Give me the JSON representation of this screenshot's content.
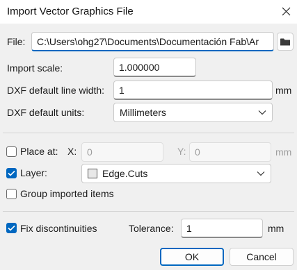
{
  "window": {
    "title": "Import Vector Graphics File",
    "close_icon": "close-icon"
  },
  "file": {
    "label": "File:",
    "value": "C:\\Users\\ohg27\\Documents\\Documentación Fab\\Ar",
    "browse_icon": "folder-icon"
  },
  "import_scale": {
    "label": "Import scale:",
    "value": "1.000000"
  },
  "dxf_line_width": {
    "label": "DXF default line width:",
    "value": "1",
    "unit": "mm"
  },
  "dxf_units": {
    "label": "DXF default units:",
    "selected": "Millimeters"
  },
  "place_at": {
    "label": "Place at:",
    "checked": false,
    "x_label": "X:",
    "x_value": "0",
    "y_label": "Y:",
    "y_value": "0",
    "unit": "mm"
  },
  "layer": {
    "label": "Layer:",
    "checked": true,
    "selected": "Edge.Cuts",
    "swatch_color": "#e8e8e8"
  },
  "group_items": {
    "label": "Group imported items",
    "checked": false
  },
  "fix_discontinuities": {
    "label": "Fix discontinuities",
    "checked": true
  },
  "tolerance": {
    "label": "Tolerance:",
    "value": "1",
    "unit": "mm"
  },
  "buttons": {
    "ok": "OK",
    "cancel": "Cancel"
  },
  "colors": {
    "accent": "#0067c0",
    "background": "#f0f0f0"
  }
}
